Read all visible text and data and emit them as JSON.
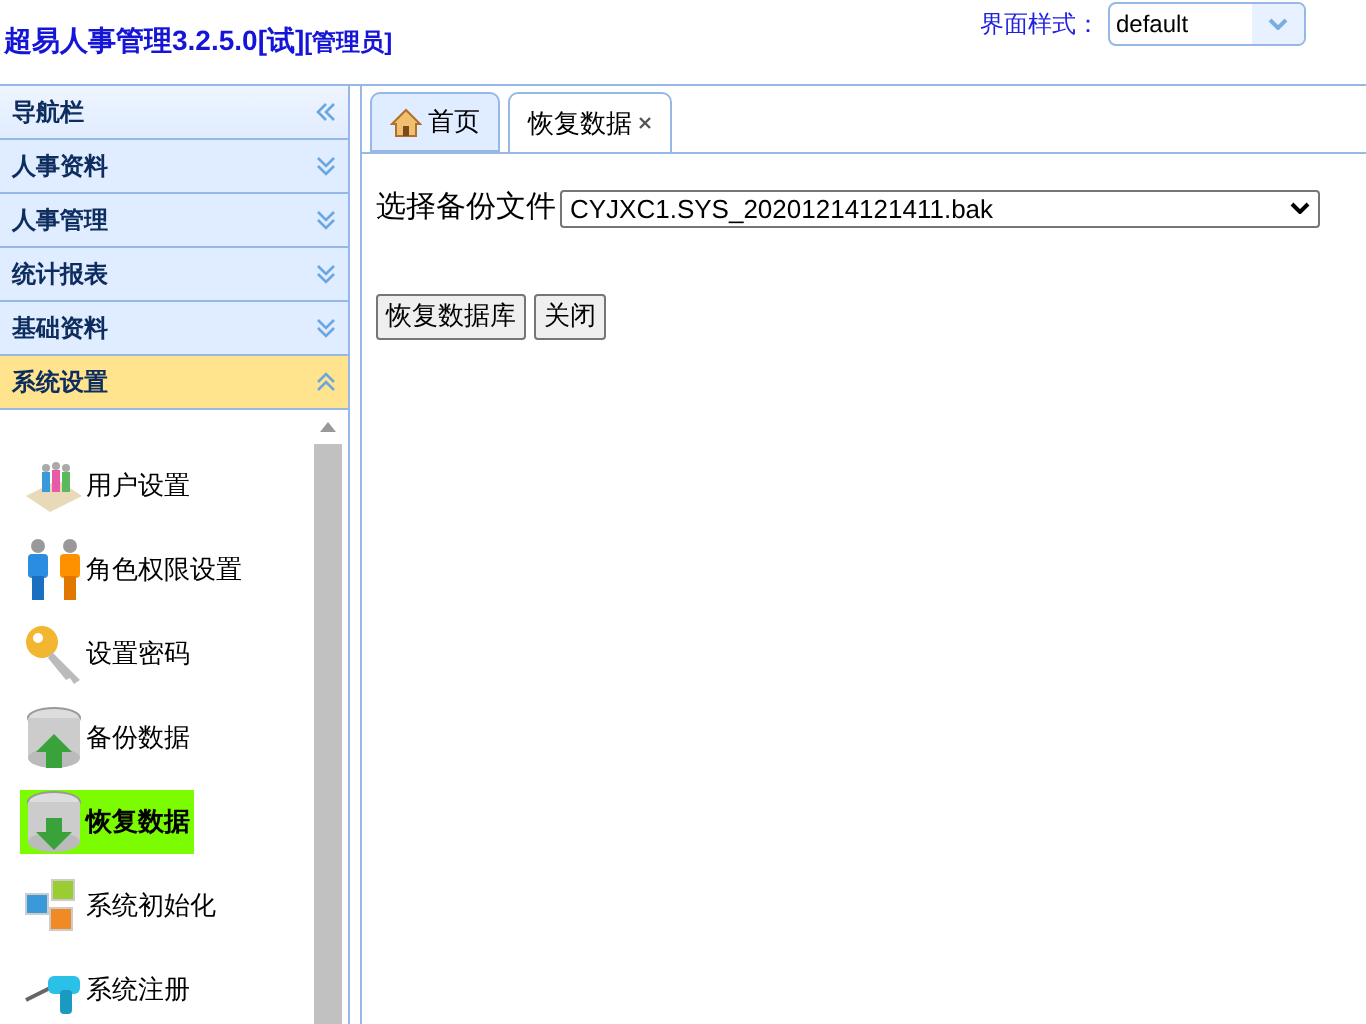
{
  "header": {
    "title": "超易人事管理3.2.5.0[试]",
    "role": "[管理员]",
    "style_label": "界面样式：",
    "style_value": "default"
  },
  "sidebar": {
    "title": "导航栏",
    "sections": [
      {
        "label": "人事资料",
        "expanded": false
      },
      {
        "label": "人事管理",
        "expanded": false
      },
      {
        "label": "统计报表",
        "expanded": false
      },
      {
        "label": "基础资料",
        "expanded": false
      },
      {
        "label": "系统设置",
        "expanded": true
      }
    ],
    "items": [
      {
        "label": "用户设置",
        "kind": "users",
        "selected": false
      },
      {
        "label": "角色权限设置",
        "kind": "roles",
        "selected": false
      },
      {
        "label": "设置密码",
        "kind": "key",
        "selected": false
      },
      {
        "label": "备份数据",
        "kind": "backup",
        "selected": false
      },
      {
        "label": "恢复数据",
        "kind": "restore",
        "selected": true
      },
      {
        "label": "系统初始化",
        "kind": "init",
        "selected": false
      },
      {
        "label": "系统注册",
        "kind": "register",
        "selected": false
      }
    ]
  },
  "tabs": [
    {
      "label": "首页",
      "kind": "home",
      "selected": false
    },
    {
      "label": "恢复数据",
      "kind": "closable",
      "selected": true
    }
  ],
  "form": {
    "file_label": "选择备份文件",
    "file_value": "CYJXC1.SYS_20201214121411.bak",
    "buttons": [
      "恢复数据库",
      "关闭"
    ]
  }
}
